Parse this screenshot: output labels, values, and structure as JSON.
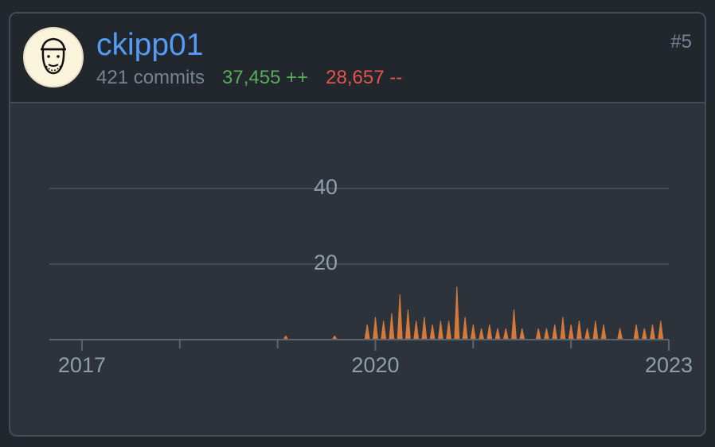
{
  "contributor": {
    "username": "ckipp01",
    "commits": "421 commits",
    "additions": "37,455 ++",
    "deletions": "28,657 --",
    "rank": "#5"
  },
  "colors": {
    "link": "#539bf5",
    "additions": "#57ab5a",
    "deletions": "#e5534b",
    "area": "#d5783a"
  },
  "chart_data": {
    "type": "area",
    "xlabel": "",
    "ylabel": "",
    "ylim": [
      0,
      50
    ],
    "y_ticks": [
      20,
      40
    ],
    "x_ticks": [
      "2017",
      "2020",
      "2023"
    ],
    "xlim": [
      "2016-09",
      "2023-01"
    ],
    "grid": true,
    "series": [
      {
        "x": [
          "2019-02",
          "2019-08",
          "2019-12",
          "2020-01",
          "2020-02",
          "2020-03",
          "2020-04",
          "2020-05",
          "2020-06",
          "2020-07",
          "2020-08",
          "2020-09",
          "2020-10",
          "2020-11",
          "2020-12",
          "2021-01",
          "2021-02",
          "2021-03",
          "2021-04",
          "2021-05",
          "2021-06",
          "2021-07",
          "2021-08",
          "2021-09",
          "2021-10",
          "2021-11",
          "2021-12",
          "2022-01",
          "2022-02",
          "2022-03",
          "2022-04",
          "2022-05",
          "2022-06",
          "2022-07",
          "2022-08",
          "2022-09",
          "2022-10",
          "2022-11",
          "2022-12"
        ],
        "values": [
          1,
          1,
          4,
          6,
          5,
          7,
          12,
          8,
          5,
          6,
          4,
          5,
          5,
          14,
          6,
          4,
          3,
          4,
          3,
          3,
          8,
          3,
          0,
          3,
          3,
          4,
          6,
          4,
          5,
          3,
          5,
          4,
          0,
          3,
          0,
          4,
          3,
          4,
          5
        ]
      }
    ]
  }
}
